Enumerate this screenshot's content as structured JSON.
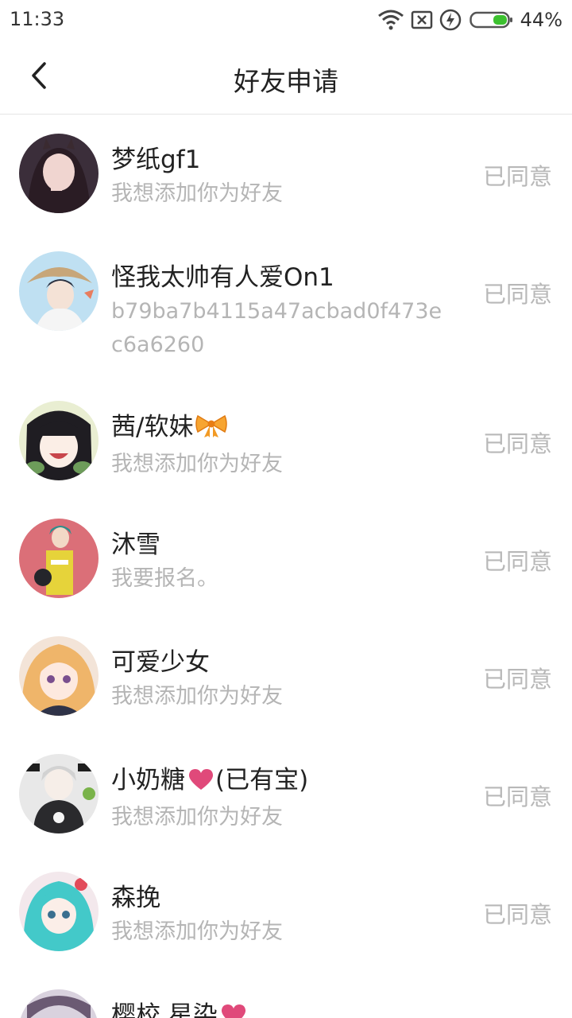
{
  "status_bar": {
    "time": "11:33",
    "battery": "44%"
  },
  "nav": {
    "title": "好友申请"
  },
  "requests": [
    {
      "name": "梦纸gf1",
      "message": "我想添加你为好友",
      "status": "已同意"
    },
    {
      "name": "怪我太帅有人爱On1",
      "message": "b79ba7b4115a47acbad0f473ec6a6260",
      "status": "已同意"
    },
    {
      "name": "茜/软妹",
      "message": "我想添加你为好友",
      "status": "已同意"
    },
    {
      "name": "沐雪",
      "message": "我要报名。",
      "status": "已同意"
    },
    {
      "name": "可爱少女",
      "message": "我想添加你为好友",
      "status": "已同意"
    },
    {
      "name": "小奶糖",
      "name_suffix": "(已有宝)",
      "message": "我想添加你为好友",
      "status": "已同意"
    },
    {
      "name": "森挽",
      "message": "我想添加你为好友",
      "status": "已同意"
    },
    {
      "name": "樱校 星染"
    }
  ],
  "colors": {
    "secondary_text": "#b5b5b5",
    "divider": "#e5e5e5",
    "heart": "#e0497a"
  },
  "icons": [
    "wifi-icon",
    "sim-off-icon",
    "charging-icon",
    "battery-icon",
    "back-icon",
    "ribbon-emoji-icon",
    "heart-emoji-icon"
  ]
}
